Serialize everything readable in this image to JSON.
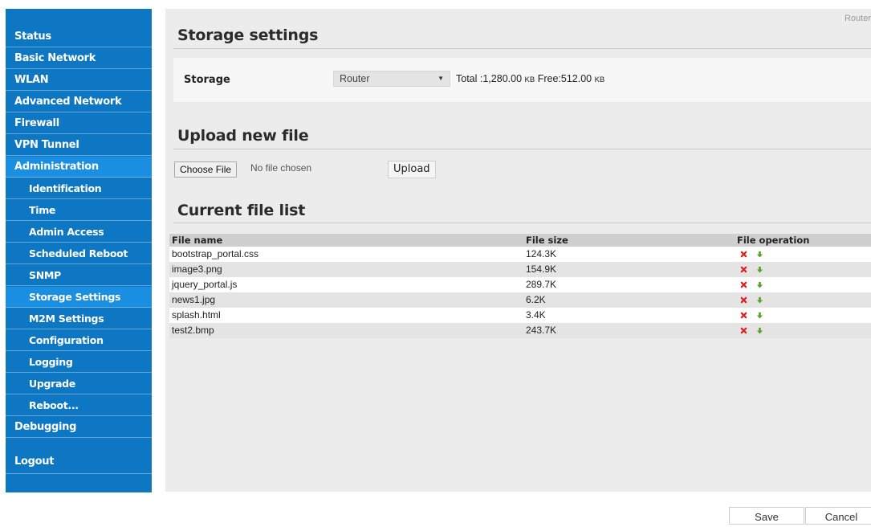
{
  "sidebar": {
    "items": [
      {
        "label": "Status"
      },
      {
        "label": "Basic Network"
      },
      {
        "label": "WLAN"
      },
      {
        "label": "Advanced Network"
      },
      {
        "label": "Firewall"
      },
      {
        "label": "VPN Tunnel"
      },
      {
        "label": "Administration"
      },
      {
        "label": "Identification"
      },
      {
        "label": "Time"
      },
      {
        "label": "Admin Access"
      },
      {
        "label": "Scheduled Reboot"
      },
      {
        "label": "SNMP"
      },
      {
        "label": "Storage Settings"
      },
      {
        "label": "M2M Settings"
      },
      {
        "label": "Configuration"
      },
      {
        "label": "Logging"
      },
      {
        "label": "Upgrade"
      },
      {
        "label": "Reboot..."
      },
      {
        "label": "Debugging"
      },
      {
        "label": "Logout"
      }
    ]
  },
  "header": {
    "router_label": "Router"
  },
  "storage": {
    "title": "Storage settings",
    "label": "Storage",
    "selected": "Router",
    "info": {
      "total_label": "Total :",
      "total_value": "1,280.00",
      "free_label": "Free:",
      "free_value": "512.00",
      "unit": "KB"
    }
  },
  "upload": {
    "title": "Upload new file",
    "choose_file_label": "Choose File",
    "no_file_text": "No file chosen",
    "upload_label": "Upload"
  },
  "file_list": {
    "title": "Current file list",
    "columns": [
      "File name",
      "File size",
      "File operation"
    ],
    "rows": [
      {
        "name": "bootstrap_portal.css",
        "size": "124.3K"
      },
      {
        "name": "image3.png",
        "size": "154.9K"
      },
      {
        "name": "jquery_portal.js",
        "size": "289.7K"
      },
      {
        "name": "news1.jpg",
        "size": "6.2K"
      },
      {
        "name": "splash.html",
        "size": "3.4K"
      },
      {
        "name": "test2.bmp",
        "size": "243.7K"
      }
    ]
  },
  "buttons": {
    "save_label": "Save",
    "cancel_label": "Cancel"
  },
  "colors": {
    "sidebar_bg": "#0e77c4",
    "sidebar_active": "#1a8ee0",
    "delete_icon": "#e02020",
    "download_icon": "#5aa02c"
  }
}
